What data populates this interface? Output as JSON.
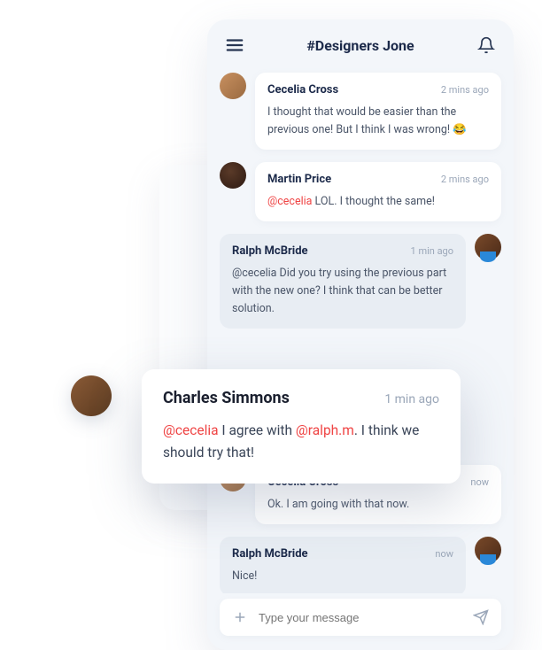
{
  "header": {
    "channel": "#Designers Jone"
  },
  "messages": [
    {
      "author": "Cecelia Cross",
      "time": "2 mins ago",
      "text": "I thought that would be easier than the previous one! But I think I was wrong! 😂"
    },
    {
      "author": "Martin Price",
      "time": "2 mins ago",
      "mention": "@cecelia",
      "text": " LOL. I thought the same!"
    },
    {
      "author": "Ralph McBride",
      "time": "1 min ago",
      "text": "@cecelia Did you try using the previous part with the new one? I think that can be better solution."
    },
    {
      "author": "Cecelia Cross",
      "time": "now",
      "text": "Ok. I am going with that now."
    },
    {
      "author": "Ralph McBride",
      "time": "now",
      "text": "Nice!"
    }
  ],
  "popup": {
    "author": "Charles Simmons",
    "time": "1 min ago",
    "mention1": "@cecelia",
    "mid": " I agree with ",
    "mention2": "@ralph.m",
    "rest": ". I think we should try that!"
  },
  "composer": {
    "placeholder": "Type your message"
  }
}
